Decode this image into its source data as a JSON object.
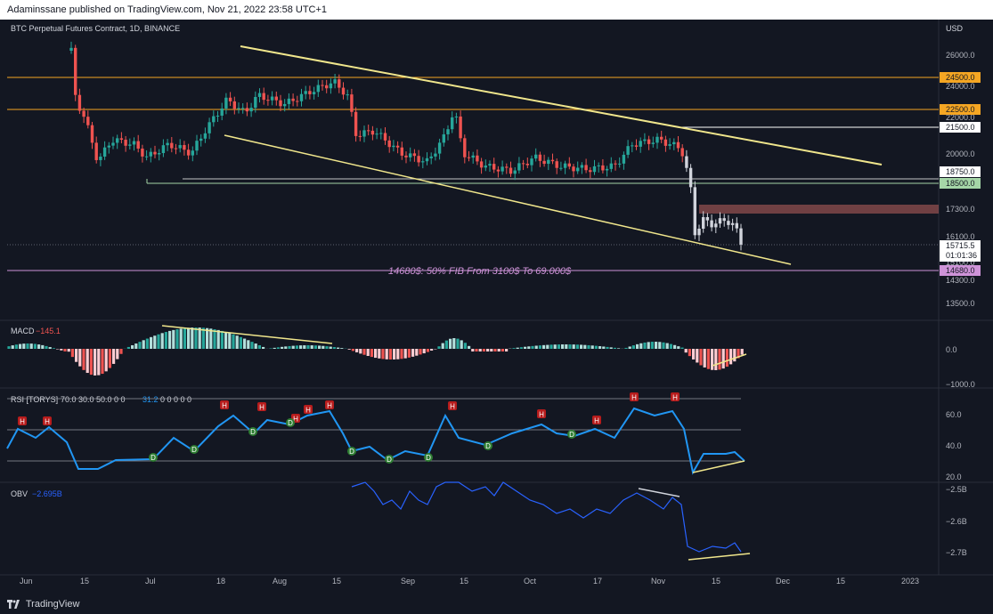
{
  "header": {
    "publish_text": "Adaminssane published on TradingView.com, Nov 21, 2022 23:58 UTC+1"
  },
  "footer": {
    "brand": "TradingView",
    "logo_icon": "tradingview-logo-icon"
  },
  "colors": {
    "background": "#131722",
    "up": "#26a69a",
    "down": "#ef5350",
    "trendline": "#f0e68c",
    "orange_level": "#f5a623",
    "green_level": "#4caf50",
    "purple_level": "#ce93d8",
    "rsi_line": "#2196f3",
    "obv_line": "#2962ff"
  },
  "main_pane": {
    "title": "BTC Perpetual Futures Contract, 1D, BINANCE",
    "currency": "USD",
    "price_ticks": [
      "26000.0",
      "24000.0",
      "22000.0",
      "20000.0",
      "17300.0",
      "16100.0",
      "15100.0",
      "14300.0",
      "13500.0"
    ],
    "level_labels": [
      {
        "text": "24500.0",
        "color": "#f5a623",
        "price": 24500
      },
      {
        "text": "22500.0",
        "color": "#f5a623",
        "price": 22500
      },
      {
        "text": "21500.0",
        "color": "#ffffff",
        "price": 21500
      },
      {
        "text": "18750.0",
        "color": "#ffffff",
        "price": 18750
      },
      {
        "text": "18500.0",
        "color": "#a5d6a7",
        "price": 18500
      },
      {
        "text": "14680.0",
        "color": "#ce93d8",
        "price": 14680
      }
    ],
    "last_price": "15715.5",
    "countdown": "01:01:36",
    "fib_annotation": "14680$: 50% FIB From 3100$ To 69.000$"
  },
  "macd_pane": {
    "title": "MACD",
    "value": "−145.1",
    "ticks": [
      "0.0",
      "−1000.0"
    ]
  },
  "rsi_pane": {
    "title": "RSI [TORYS]",
    "params": "70.0 30.0 50.0 0 0",
    "value": "31.2",
    "params_tail": "0 0 0 0 0",
    "ticks": [
      "60.0",
      "40.0",
      "20.0"
    ],
    "high_marker": "H",
    "low_marker": "D"
  },
  "obv_pane": {
    "title": "OBV",
    "value": "−2.695B",
    "ticks": [
      "−2.5B",
      "−2.6B",
      "−2.7B"
    ]
  },
  "time_axis": [
    "Jun",
    "15",
    "Jul",
    "18",
    "Aug",
    "15",
    "Sep",
    "15",
    "Oct",
    "17",
    "Nov",
    "15",
    "Dec",
    "15",
    "2023"
  ]
}
